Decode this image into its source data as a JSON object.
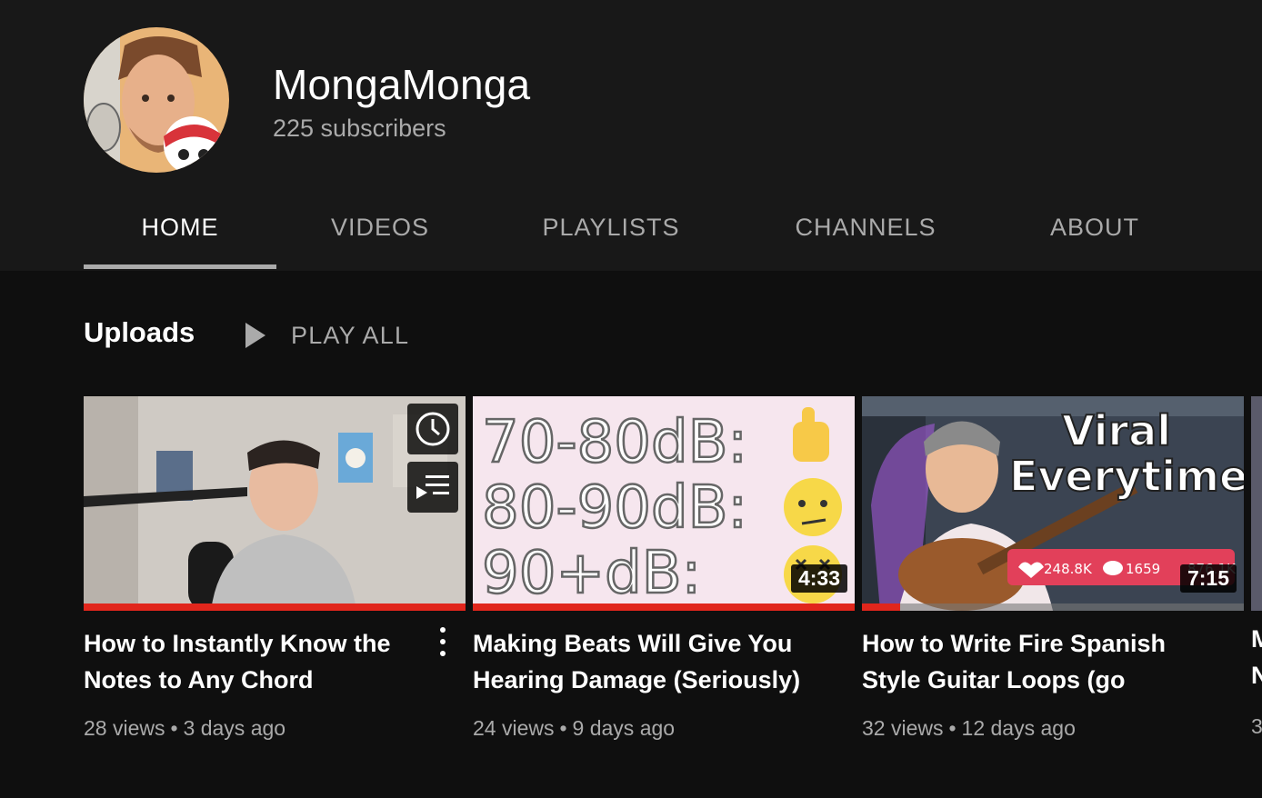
{
  "channel": {
    "name": "MongaMonga",
    "subscribers": "225 subscribers"
  },
  "tabs": [
    "HOME",
    "VIDEOS",
    "PLAYLISTS",
    "CHANNELS",
    "ABOUT"
  ],
  "active_tab": "HOME",
  "shelf": {
    "title": "Uploads",
    "play_all_label": "PLAY ALL"
  },
  "videos": [
    {
      "title": "How to Instantly Know the Notes to Any Chord (Minim…",
      "views": "28 views",
      "age": "3 days ago",
      "duration": "",
      "progress_fraction": 1.0
    },
    {
      "title": "Making Beats Will Give You Hearing Damage (Seriously)",
      "views": "24 views",
      "age": "9 days ago",
      "duration": "4:33",
      "progress_fraction": 1.0,
      "thumb_lines": [
        "70-80dB:",
        "80-90dB:",
        "90+dB:"
      ]
    },
    {
      "title": "How to Write Fire Spanish Style Guitar Loops (go viral…",
      "views": "32 views",
      "age": "12 days ago",
      "duration": "7:15",
      "progress_fraction": 0.1,
      "thumb_text": [
        "Viral",
        "Everytime"
      ],
      "thumb_stats": [
        "248.8K",
        "1659",
        "876.1K"
      ]
    }
  ],
  "peek": {
    "line1": "M",
    "line2": "N",
    "line3": "3"
  },
  "colors": {
    "header_bg": "#181818",
    "page_bg": "#0f0f0f",
    "progress_red": "#e1261c",
    "secondary_text": "#aaaaaa"
  }
}
